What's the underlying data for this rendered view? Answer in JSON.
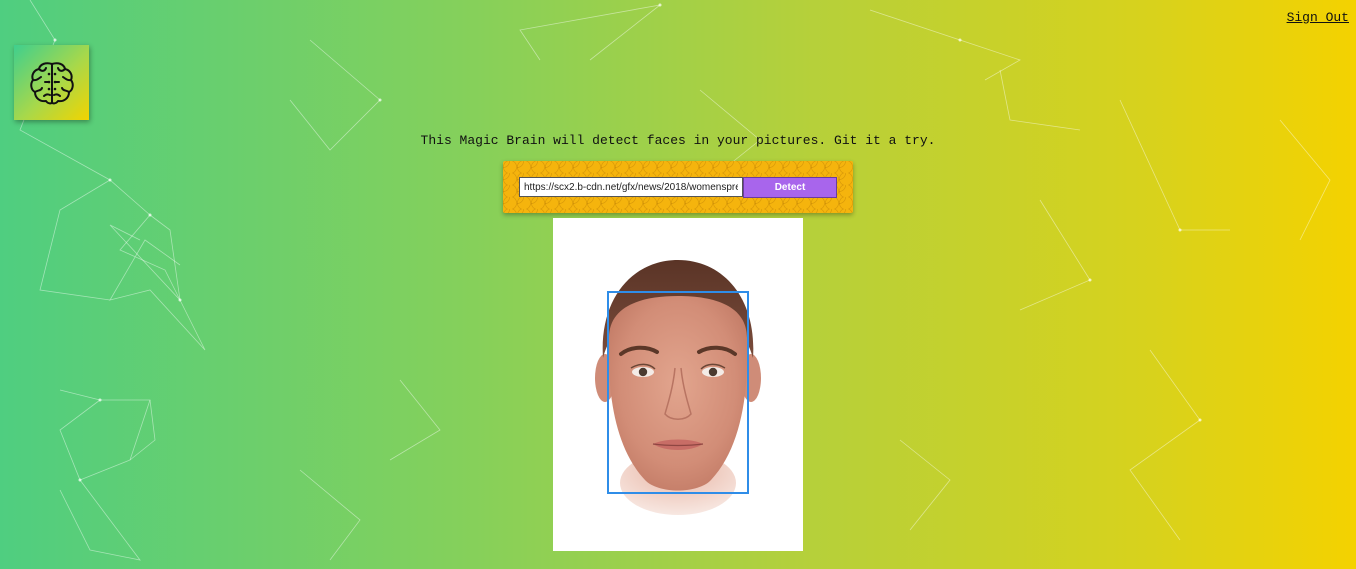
{
  "header": {
    "signout_label": "Sign Out"
  },
  "logo": {
    "icon": "brain-icon"
  },
  "main": {
    "tagline": "This Magic Brain will detect faces in your pictures. Git it a try.",
    "url_input": {
      "value": "https://scx2.b-cdn.net/gfx/news/2018/womenspre",
      "placeholder": ""
    },
    "detect_label": "Detect",
    "image": {
      "subject": "face-photo",
      "faces_detected": 1
    }
  },
  "colors": {
    "gradient_start": "#4fce80",
    "gradient_end": "#f4d200",
    "form_background": "#f5b40d",
    "button": "#a865ec",
    "bounding_box": "#2f8de8"
  }
}
